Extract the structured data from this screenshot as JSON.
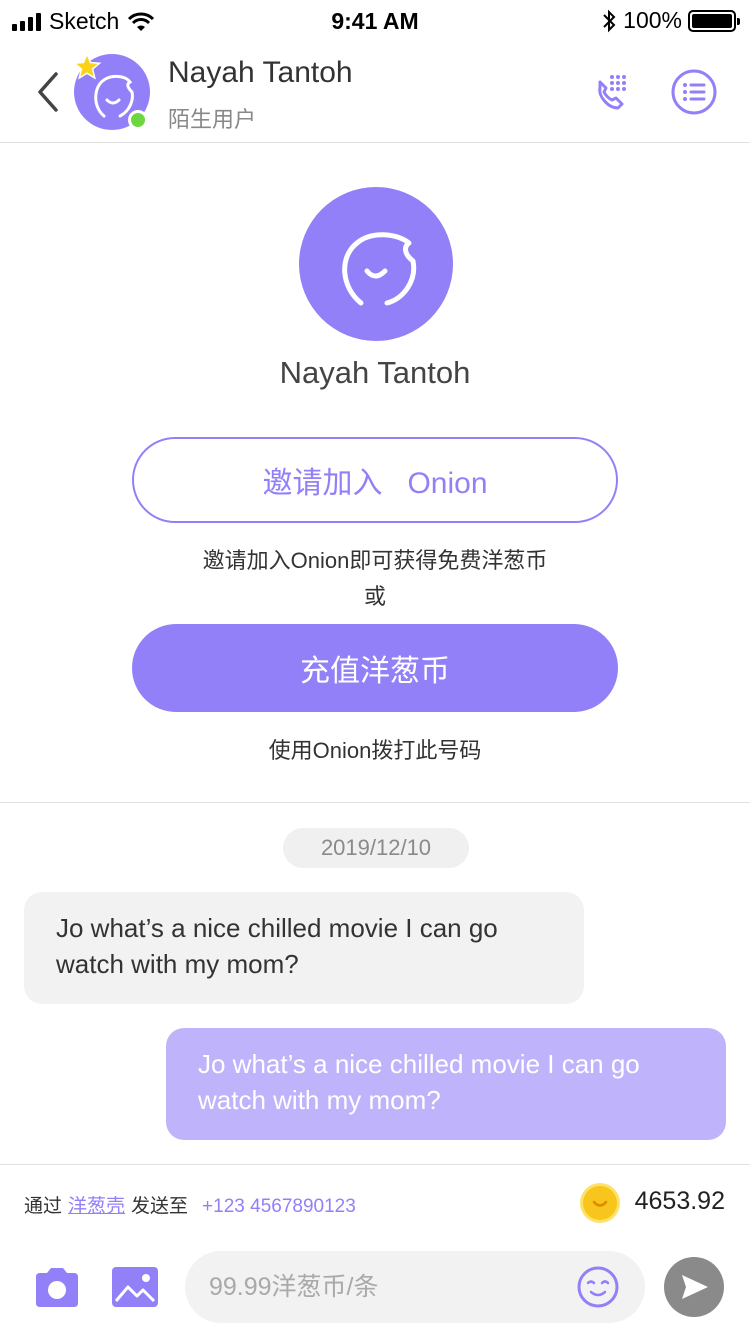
{
  "status_bar": {
    "carrier": "Sketch",
    "time": "9:41 AM",
    "battery": "100%"
  },
  "header": {
    "contact_name": "Nayah Tantoh",
    "contact_subtitle": "陌生用户"
  },
  "profile": {
    "name": "Nayah Tantoh",
    "invite_button": "邀请加入   Onion",
    "invite_hint": "邀请加入Onion即可获得免费洋葱币",
    "or_text": "或",
    "recharge_button": "充值洋葱币",
    "call_hint": "使用Onion拨打此号码"
  },
  "chat": {
    "date": "2019/12/10",
    "messages": [
      {
        "direction": "incoming",
        "text": "Jo what’s a nice chilled movie I can go watch with my mom?"
      },
      {
        "direction": "outgoing",
        "text": "Jo what’s a nice chilled movie I can go watch with my mom?"
      }
    ]
  },
  "composer": {
    "via_prefix": "通过",
    "via_link": "洋葱壳",
    "send_to": "发送至",
    "phone": "+123 4567890123",
    "balance": "4653.92",
    "input_placeholder": "99.99洋葱币/条"
  },
  "icons": {
    "back": "chevron-left-icon",
    "star": "star-icon",
    "call": "phone-dialpad-icon",
    "menu": "list-menu-icon",
    "camera": "camera-icon",
    "image": "image-icon",
    "emoji": "emoji-icon",
    "send": "send-icon",
    "coin": "coin-icon"
  },
  "colors": {
    "accent": "#9280f8",
    "outgoing_bubble": "#bfb4fb",
    "incoming_bubble": "#f2f2f2",
    "online": "#6ed640",
    "send_button": "#8a8a8a"
  }
}
